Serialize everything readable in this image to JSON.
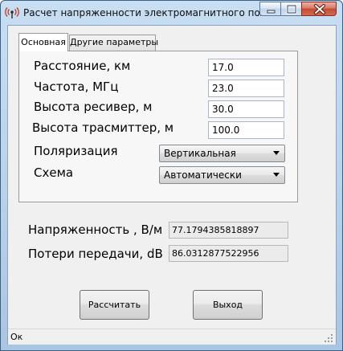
{
  "window": {
    "title": "Расчет напряженности электромагнитного поля",
    "icon": "radio-antenna-icon"
  },
  "tabs": [
    {
      "label": "Основная",
      "selected": true
    },
    {
      "label": "Другие параметры",
      "selected": false
    }
  ],
  "form": {
    "distance_label": "Расстояние, км",
    "distance_value": "17.0",
    "frequency_label": "Частота, МГц",
    "frequency_value": "23.0",
    "receiver_height_label": "Высота  ресивер, м",
    "receiver_height_value": "30.0",
    "transmitter_height_label": "Высота  трасмиттер, м",
    "transmitter_height_value": "100.0",
    "polarization_label": "Поляризация",
    "polarization_value": "Вертикальная",
    "scheme_label": "Схема",
    "scheme_value": "Автоматически"
  },
  "results": {
    "field_strength_label": "Напряженность , В/м",
    "field_strength_value": "77.1794385818897",
    "transmission_loss_label": "Потери передачи, dB",
    "transmission_loss_value": "86.0312877522956"
  },
  "buttons": {
    "calculate": "Рассчитать",
    "exit": "Выход"
  },
  "status": {
    "text": "Ок"
  },
  "colors": {
    "titlebar": "#b9d2ea",
    "close_button": "#c44a33",
    "client_background": "#f0f0f0"
  }
}
